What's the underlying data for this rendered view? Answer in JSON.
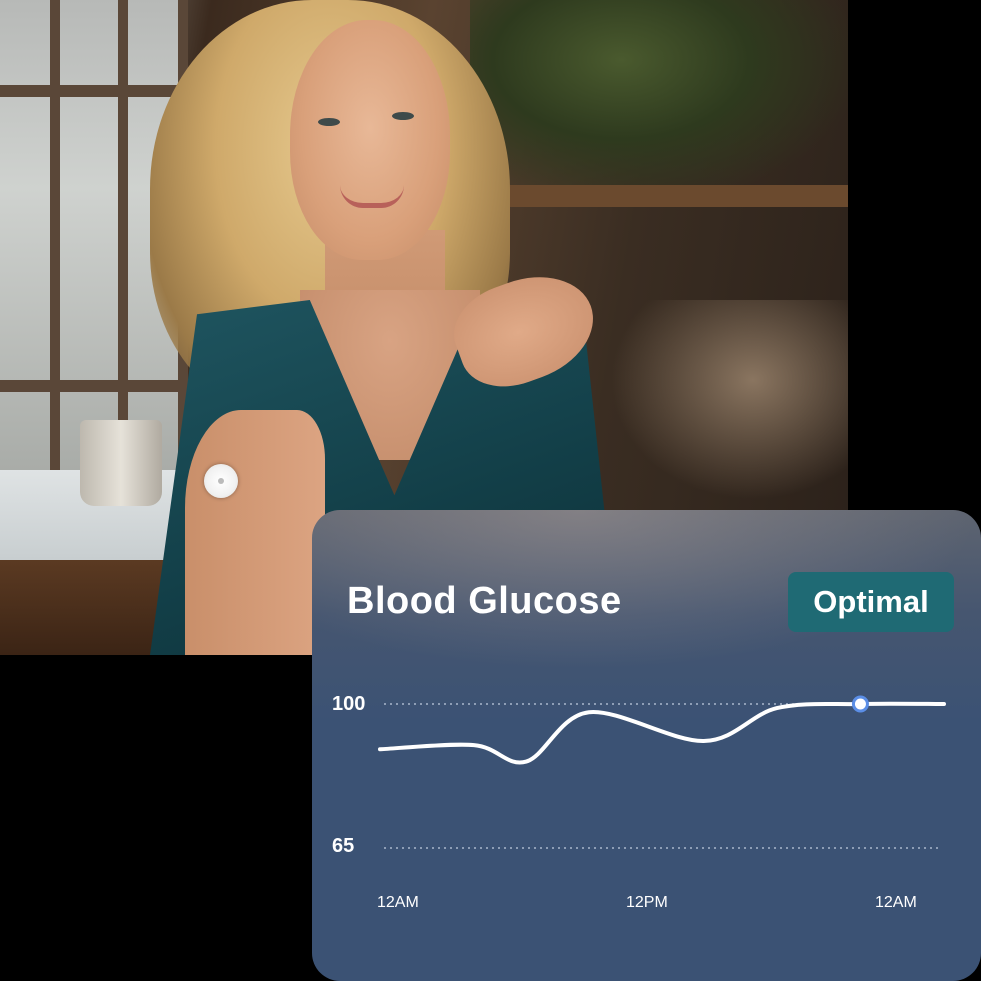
{
  "card": {
    "title": "Blood Glucose",
    "status_badge": "Optimal"
  },
  "colors": {
    "card_background": "#3b5274",
    "badge_background": "#1f6a74",
    "line": "#ffffff",
    "marker": "#5b8ee6"
  },
  "chart_data": {
    "type": "line",
    "title": "Blood Glucose",
    "y_ticks": [
      "100",
      "65"
    ],
    "x_ticks": [
      "12AM",
      "12PM",
      "12AM"
    ],
    "ylim": [
      65,
      100
    ],
    "grid": "dotted horizontal lines at y-ticks",
    "series": [
      {
        "x": [
          0,
          4.5,
          7,
          10,
          15.5,
          19,
          23,
          27
        ],
        "values": [
          89,
          90,
          86,
          98,
          91,
          99,
          100,
          100
        ]
      }
    ],
    "highlighted_point": {
      "x": 23,
      "value": 100
    }
  }
}
